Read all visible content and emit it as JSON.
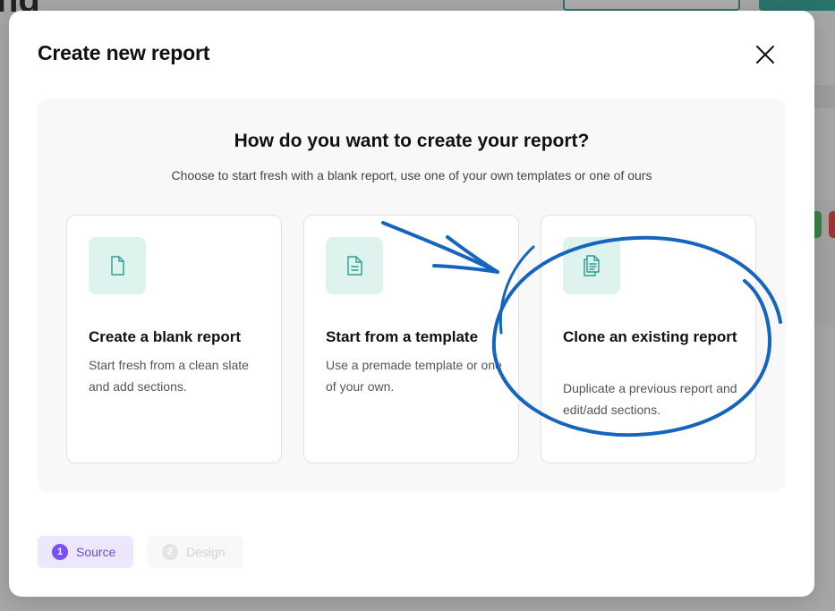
{
  "background": {
    "page_title_fragment": "ng"
  },
  "modal": {
    "title": "Create new report",
    "heading": "How do you want to create your report?",
    "subheading": "Choose to start fresh with a blank report, use one of your own templates or one of ours",
    "options": [
      {
        "title": "Create a blank report",
        "description": "Start fresh from a clean slate and add sections.",
        "icon": "blank-document-icon"
      },
      {
        "title": "Start from a template",
        "description": "Use a premade template or one of your own.",
        "icon": "template-document-icon"
      },
      {
        "title": "Clone an existing report",
        "description": "Duplicate a previous report and edit/add sections.",
        "icon": "clone-documents-icon"
      }
    ],
    "steps": [
      {
        "number": "1",
        "label": "Source",
        "state": "active"
      },
      {
        "number": "2",
        "label": "Design",
        "state": "inactive"
      }
    ]
  },
  "colors": {
    "accent_teal": "#1a9c8c",
    "icon_tile": "#dff3ee",
    "step_active_bg": "#ede7fb",
    "step_active_text": "#7048e8",
    "annotation_blue": "#1565c0"
  }
}
